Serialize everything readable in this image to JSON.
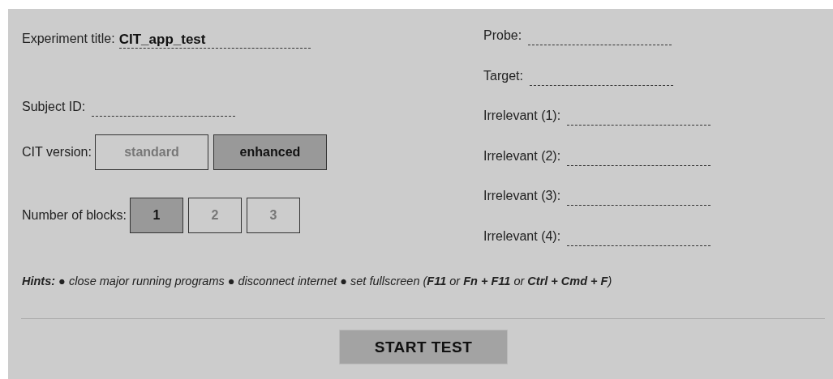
{
  "experiment_title": {
    "label": "Experiment title:",
    "value": "CIT_app_test"
  },
  "subject_id": {
    "label": "Subject ID:"
  },
  "cit_version": {
    "label": "CIT version:",
    "options": [
      {
        "label": "standard",
        "selected": false
      },
      {
        "label": "enhanced",
        "selected": true
      }
    ]
  },
  "number_of_blocks": {
    "label": "Number of blocks:",
    "options": [
      {
        "label": "1",
        "selected": true
      },
      {
        "label": "2",
        "selected": false
      },
      {
        "label": "3",
        "selected": false
      }
    ]
  },
  "items": [
    {
      "label": "Probe:"
    },
    {
      "label": "Target:"
    },
    {
      "label": "Irrelevant (1):"
    },
    {
      "label": "Irrelevant (2):"
    },
    {
      "label": "Irrelevant (3):"
    },
    {
      "label": "Irrelevant (4):"
    }
  ],
  "hints": "**Hints:** ● close major running programs ● disconnect internet ● set fullscreen (**F11** or **Fn + F11** or **Ctrl + Cmd + F**)",
  "start_button": "START TEST"
}
